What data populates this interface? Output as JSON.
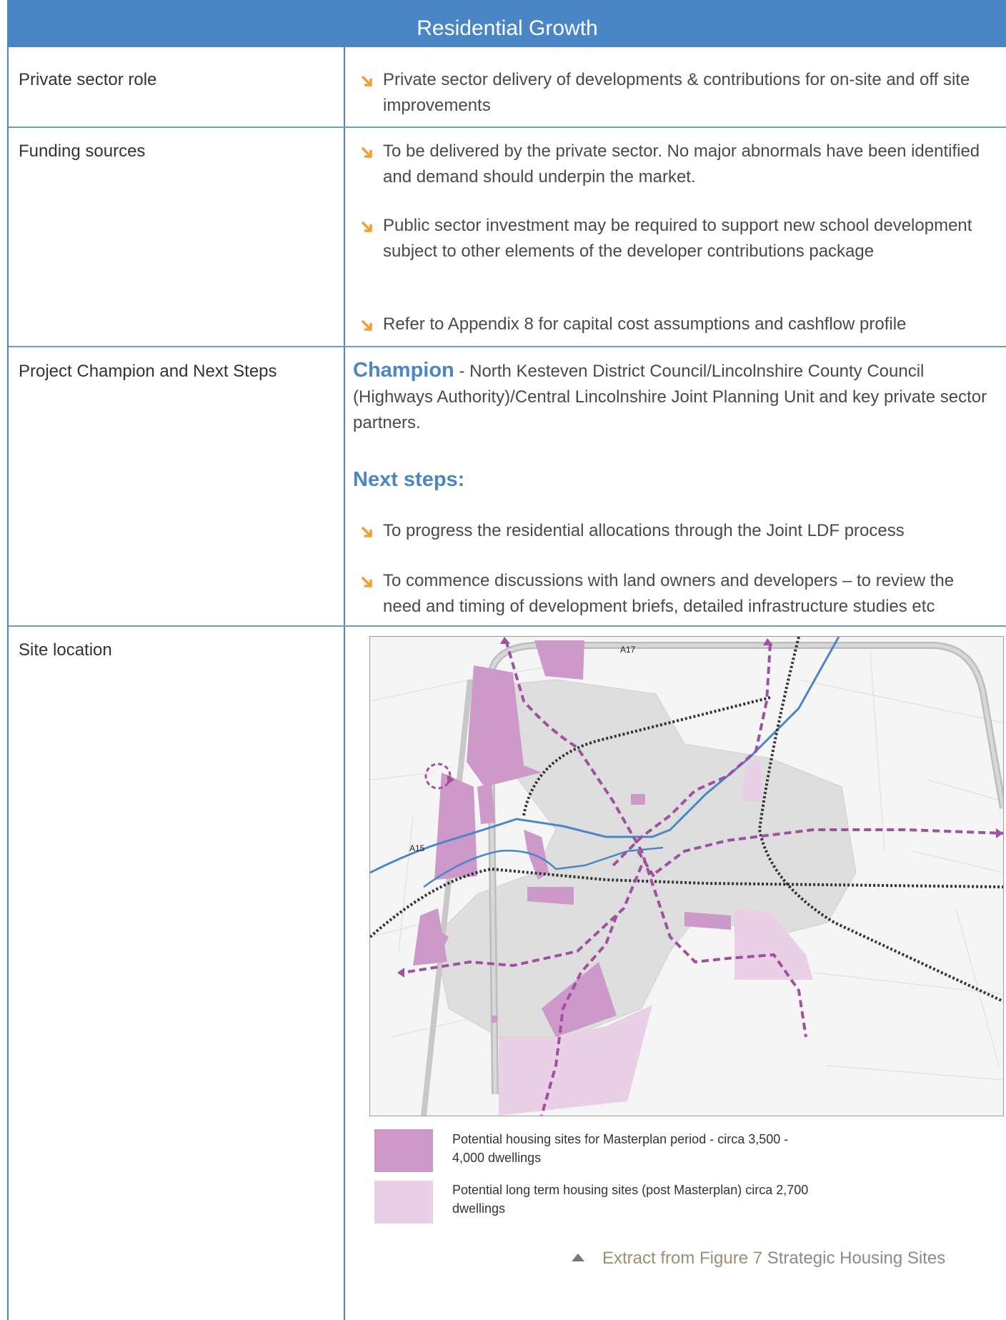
{
  "header": {
    "title": "Residential Growth"
  },
  "rows": {
    "private_sector": {
      "label": "Private sector role",
      "bullets": [
        "Private sector delivery of developments & contributions for on-site and off site improvements"
      ]
    },
    "funding": {
      "label": "Funding sources",
      "bullets": [
        "To be delivered by the private sector. No major abnormals have been identified and demand should underpin the market.",
        "Public sector investment may be required to support new school development subject to other elements of the developer contributions package",
        "Refer to Appendix 8 for capital cost assumptions and cashflow profile"
      ]
    },
    "champion": {
      "label": "Project Champion and Next Steps",
      "champion_title": "Champion",
      "champion_text": " - North Kesteven District Council/Lincolnshire County Council (Highways Authority)/Central Lincolnshire Joint Planning Unit and key private sector partners.",
      "next_title": "Next steps:",
      "bullets": [
        "To progress the residential allocations through the Joint LDF process",
        "To commence discussions with land owners and developers – to review the need and timing of development briefs, detailed infrastructure studies etc"
      ]
    },
    "site": {
      "label": "Site location",
      "map_labels": {
        "road_a17": "A17",
        "road_a15": "A15"
      },
      "legend": [
        {
          "color": "#cc99c9",
          "text": "Potential housing sites for Masterplan period - circa 3,500 - 4,000 dwellings"
        },
        {
          "color": "#e9d0e6",
          "text": "Potential long term housing sites (post Masterplan) circa 2,700 dwellings"
        }
      ],
      "caption_bold": "Extract from Figure 7",
      "caption_rest": " Strategic Housing Sites"
    }
  },
  "colors": {
    "accent": "#4a86c6",
    "bullet": "#f0a030",
    "housing": "#cc99c9",
    "housing_long": "#e9d0e6",
    "route": "#a050a0"
  }
}
